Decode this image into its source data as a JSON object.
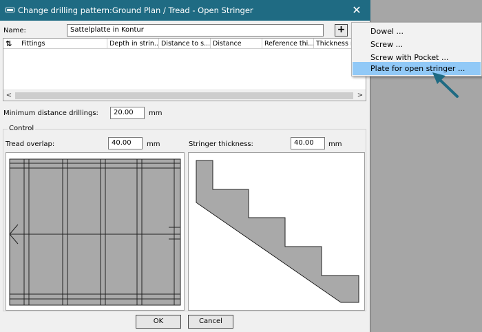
{
  "window": {
    "title": "Change drilling pattern:Ground Plan / Tread - Open Stringer",
    "close_glyph": "✕"
  },
  "name_row": {
    "label": "Name:",
    "value": "Sattelplatte in Kontur",
    "add_glyph": "+"
  },
  "table": {
    "sort_glyph": "⇅",
    "columns": [
      "Fittings",
      "Depth in strin...",
      "Distance to s...",
      "Distance",
      "Reference thi...",
      "Thickness re"
    ],
    "rows": [],
    "scroll_left": "<",
    "scroll_right": ">"
  },
  "min_distance": {
    "label": "Minimum distance drillings:",
    "value": "20.00",
    "unit": "mm"
  },
  "control": {
    "title": "Control",
    "tread_overlap": {
      "label": "Tread overlap:",
      "value": "40.00",
      "unit": "mm"
    },
    "stringer_thickness": {
      "label": "Stringer thickness:",
      "value": "40.00",
      "unit": "mm"
    }
  },
  "buttons": {
    "ok": "OK",
    "cancel": "Cancel"
  },
  "menu": {
    "items": [
      "Dowel ...",
      "Screw ...",
      "Screw with Pocket ...",
      "Plate for open stringer ..."
    ],
    "selected_index": 3
  },
  "colors": {
    "titlebar": "#1f6b83",
    "menu_highlight": "#91c9f7",
    "arrow": "#1f6b83",
    "preview_fill": "#a9a9a9"
  }
}
